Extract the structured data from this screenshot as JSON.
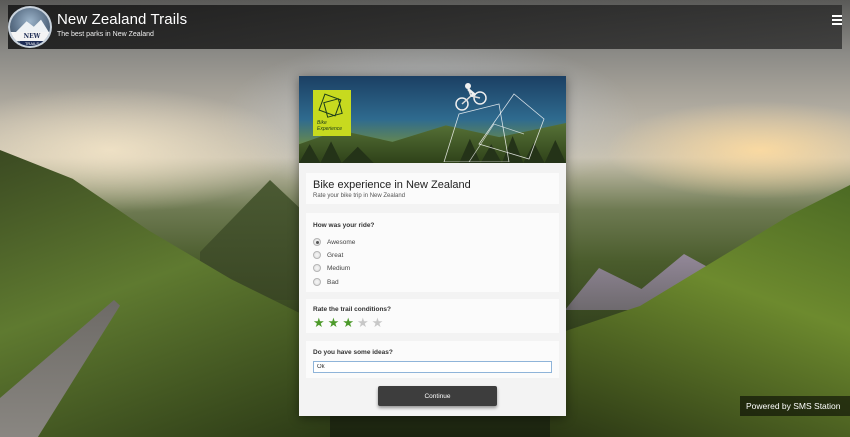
{
  "header": {
    "title": "New Zealand Trails",
    "subtitle": "The best parks in New Zealand",
    "logo_text": "NEW ZEALAND",
    "logo_subtext": "TRAILS",
    "menu_icon": "hamburger-icon"
  },
  "hero": {
    "badge_text_line1": "Bike",
    "badge_text_line2": "Experience"
  },
  "survey": {
    "title": "Bike experience in New Zealand",
    "subtitle": "Rate your bike trip in New Zealand",
    "question1": {
      "label": "How was your ride?",
      "options": [
        "Awesome",
        "Great",
        "Medium",
        "Bad"
      ],
      "selected": "Awesome"
    },
    "question2": {
      "label": "Rate the trail conditions?",
      "rating": 3,
      "max": 5,
      "active_color": "#4c9a2a",
      "inactive_color": "#c8c8c8"
    },
    "question3": {
      "label": "Do you have some ideas?",
      "value": "Ok"
    },
    "continue_label": "Continue"
  },
  "footer": {
    "powered_by": "Powered by SMS Station"
  }
}
